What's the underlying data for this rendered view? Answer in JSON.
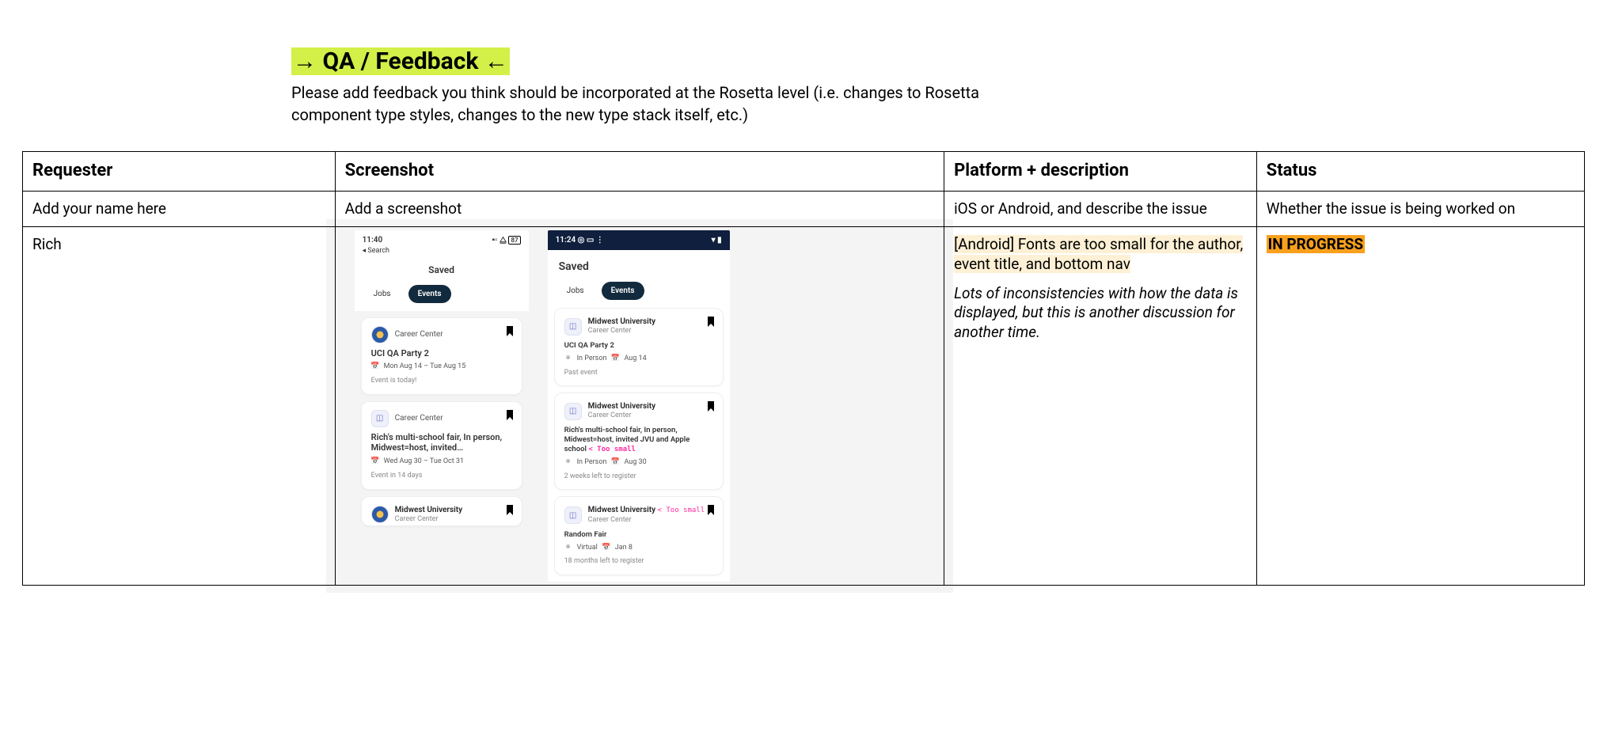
{
  "header": {
    "title": "→ QA / Feedback ←",
    "subtext": "Please add feedback you think should be incorporated at the Rosetta level (i.e. changes to Rosetta component type styles, changes to the new type stack itself, etc.)"
  },
  "table": {
    "headers": {
      "requester": "Requester",
      "screenshot": "Screenshot",
      "platform_desc": "Platform + description",
      "status": "Status"
    },
    "helper_row": {
      "requester": "Add your name here",
      "screenshot": "Add a screenshot",
      "platform_desc": "iOS or Android, and describe the issue",
      "status": "Whether the issue is being worked on"
    },
    "rows": [
      {
        "requester": "Rich",
        "platform_desc_highlight": "[Android] Fonts are too small for the author, event title, and bottom nav",
        "platform_desc_italic": "Lots of inconsistencies with how the data is displayed, but this is another discussion for another time.",
        "status": "IN PROGRESS",
        "screenshot": {
          "ios": {
            "time": "11:40",
            "battery": "87",
            "back": "◂ Search",
            "title": "Saved",
            "tab_jobs": "Jobs",
            "tab_events": "Events",
            "cards": [
              {
                "org": "Career Center",
                "title": "UCI QA Party 2",
                "date": "Mon Aug 14 – Tue Aug 15",
                "footer": "Event is today!",
                "avatar_type": "circle"
              },
              {
                "org": "Career Center",
                "title": "Rich's multi-school fair, In person, Midwest=host, invited…",
                "date": "Wed Aug 30 – Tue Oct 31",
                "footer": "Event in 14 days",
                "avatar_type": "square"
              },
              {
                "uni": "Midwest University",
                "org": "Career Center",
                "avatar_type": "circle"
              }
            ]
          },
          "android": {
            "time": "11:24",
            "title": "Saved",
            "tab_jobs": "Jobs",
            "tab_events": "Events",
            "cards": [
              {
                "uni": "Midwest University",
                "org": "Career Center",
                "title": "UCI QA Party 2",
                "loc": "In Person",
                "date": "Aug 14",
                "footer": "Past event"
              },
              {
                "uni": "Midwest University",
                "org": "Career Center",
                "title": "Rich's multi-school fair, In person, Midwest=host, invited JVU and Apple school",
                "annot": "< Too small",
                "loc": "In Person",
                "date": "Aug 30",
                "footer": "2 weeks left to register"
              },
              {
                "uni": "Midwest University",
                "org": "Career Center",
                "annot": "< Too small",
                "title": "Random Fair",
                "loc": "Virtual",
                "date": "Jan 8",
                "footer": "18 months left to register"
              }
            ]
          }
        }
      }
    ]
  }
}
